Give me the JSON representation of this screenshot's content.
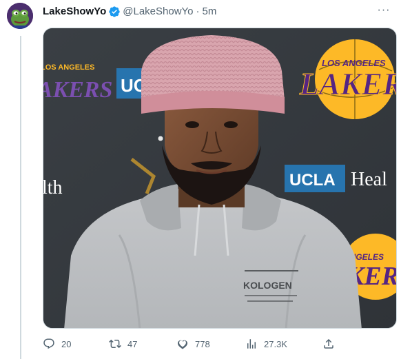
{
  "tweet": {
    "author": {
      "display_name": "LakeShowYo",
      "handle": "@LakeShowYo",
      "verified": true,
      "avatar_icon": "frog-avatar"
    },
    "separator": "·",
    "timestamp": "5m",
    "more_label": "···",
    "media": {
      "backdrop_text": {
        "lakers_logo_arc": "LOS ANGELES",
        "lakers_logo_word": "LAKERS",
        "lakers_logo_right_arc": "ANGELES",
        "lakers_logo_right_word": "KERS",
        "ucla_badge_top": "UCL",
        "ucla_badge_main": "UCLA",
        "health_text": "Heal",
        "health_text_left": "lth"
      },
      "hoodie_print": "KOLOGEN"
    },
    "actions": {
      "replies": "20",
      "retweets": "47",
      "likes": "778",
      "views": "27.3K"
    },
    "colors": {
      "verified": "#1d9bf0",
      "text_secondary": "#536471",
      "lakers_purple": "#552583",
      "lakers_gold": "#fdb927",
      "ucla_blue": "#2774ae"
    }
  }
}
